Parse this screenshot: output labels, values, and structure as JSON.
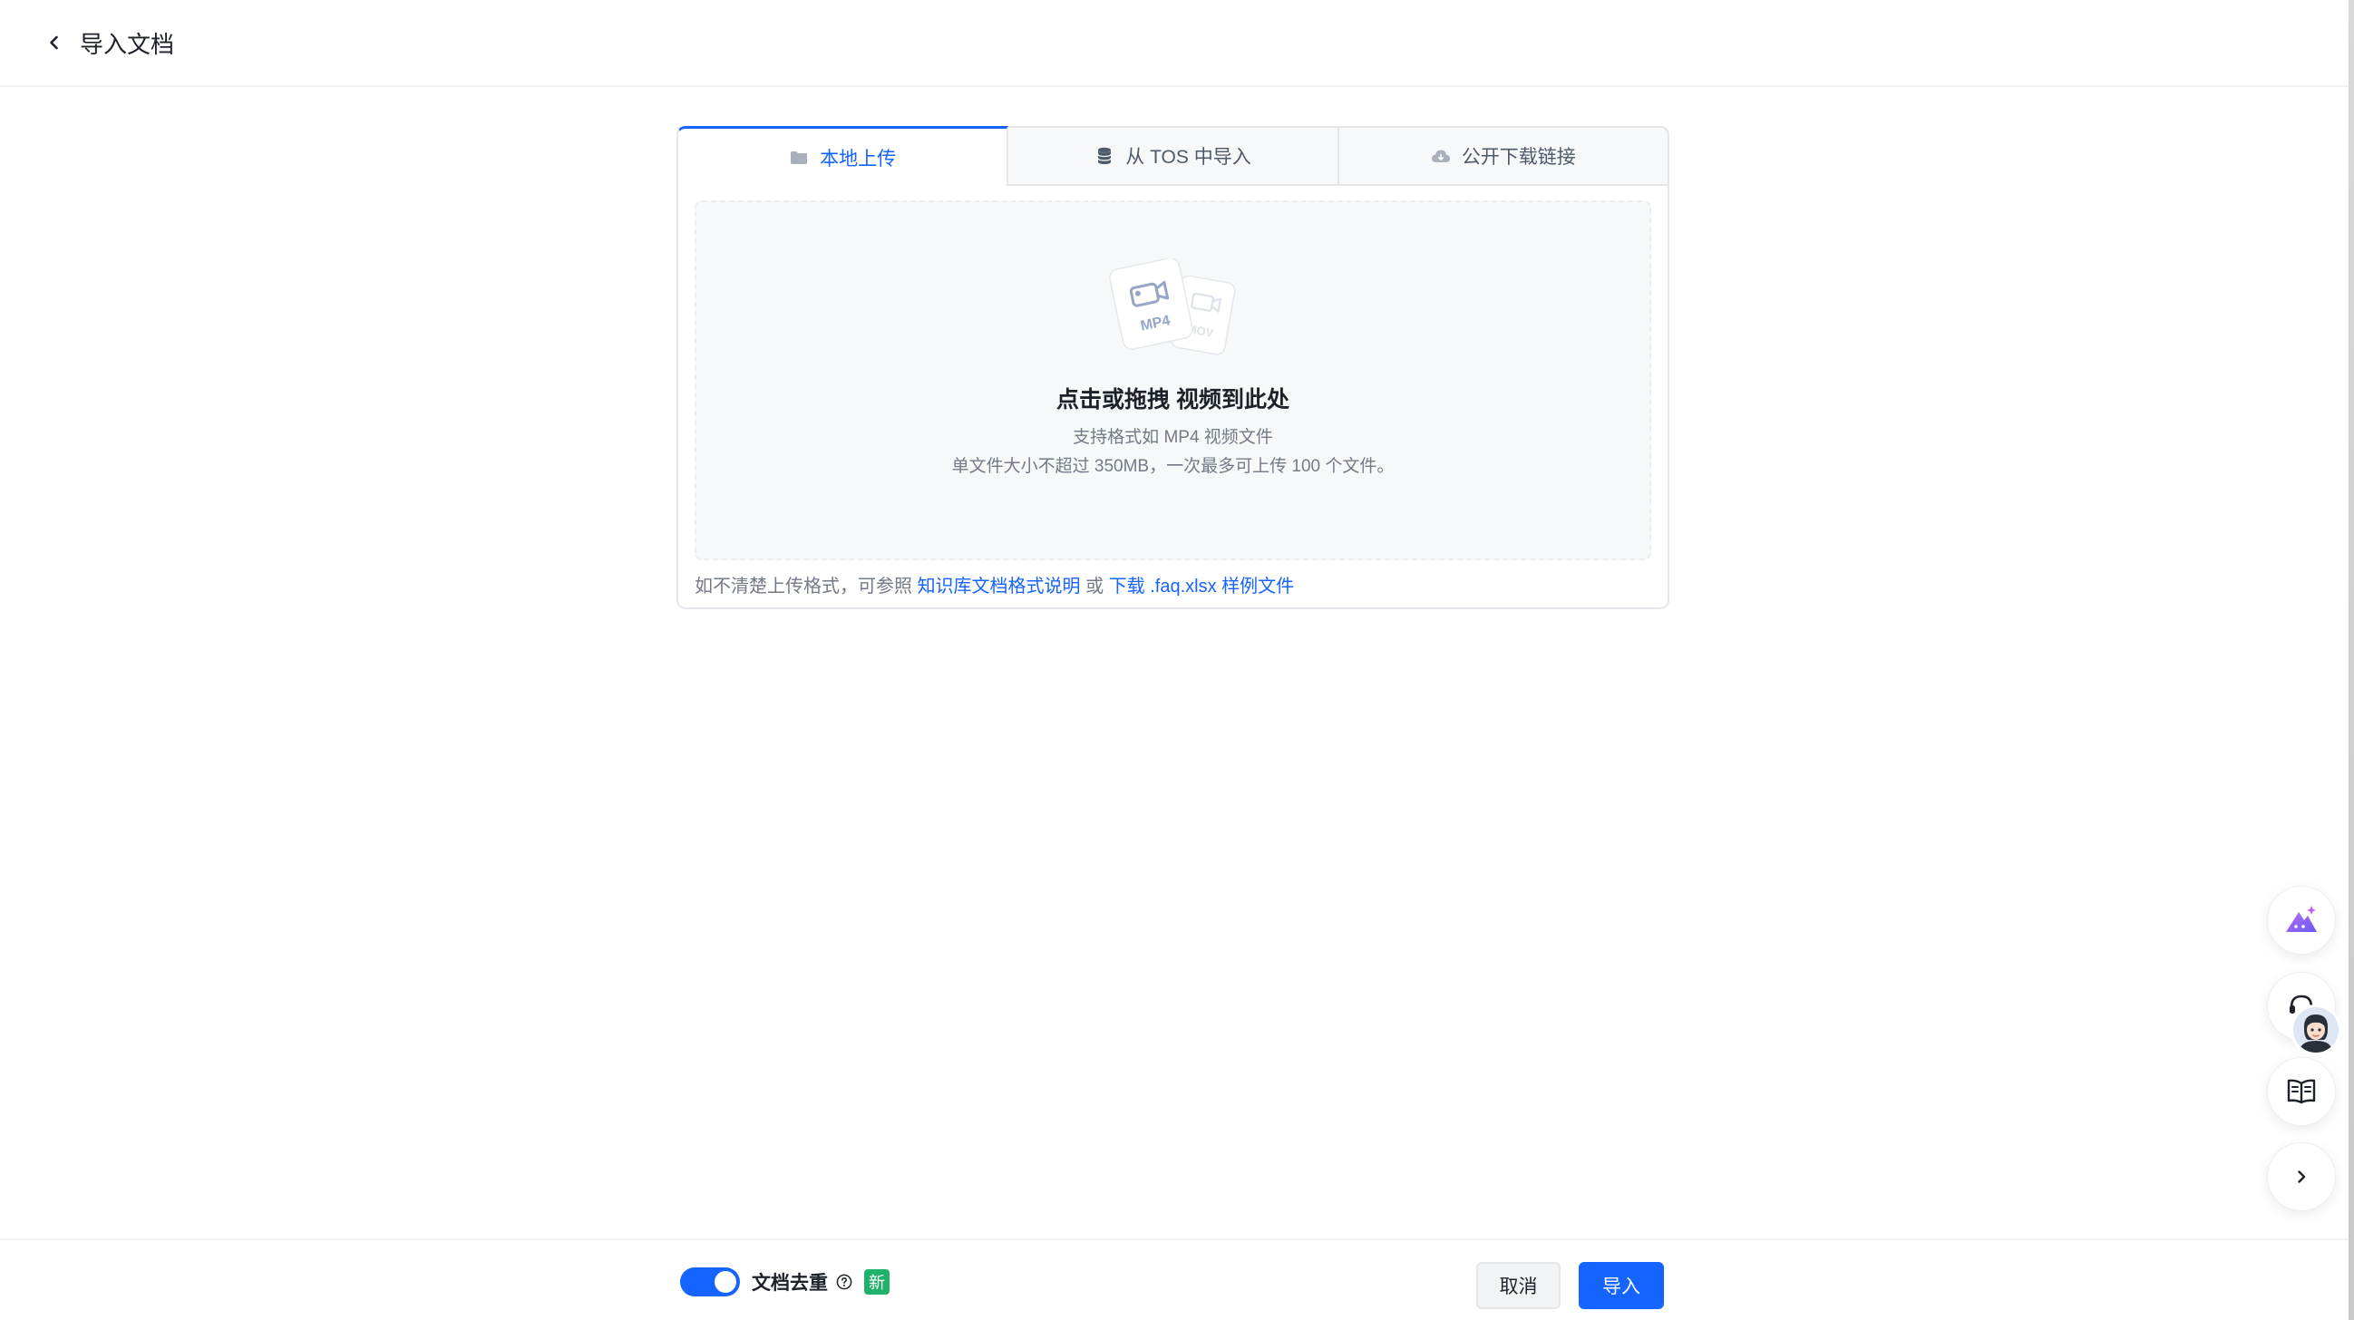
{
  "header": {
    "title": "导入文档"
  },
  "tabs": [
    {
      "label": "本地上传",
      "icon": "folder-icon",
      "active": true
    },
    {
      "label": "从 TOS 中导入",
      "icon": "database-icon",
      "active": false
    },
    {
      "label": "公开下载链接",
      "icon": "cloud-icon",
      "active": false
    }
  ],
  "dropzone": {
    "illustration_labels": [
      "MP4",
      "MOV"
    ],
    "title": "点击或拖拽 视频到此处",
    "line1": "支持格式如 MP4 视频文件",
    "line2": "单文件大小不超过 350MB，一次最多可上传 100 个文件。"
  },
  "hint": {
    "prefix": "如不清楚上传格式，可参照 ",
    "link1": "知识库文档格式说明",
    "middle": " 或 ",
    "link2": "下载 .faq.xlsx 样例文件"
  },
  "footer": {
    "dedup_label": "文档去重",
    "dedup_enabled": true,
    "new_badge": "新",
    "cancel_label": "取消",
    "import_label": "导入"
  },
  "floating_tools": [
    "ai-assistant-icon",
    "customer-service-icon",
    "book-icon",
    "chevron-right-icon"
  ],
  "colors": {
    "primary": "#1664ff",
    "new_badge": "#20b26b",
    "text_secondary": "#737a87"
  }
}
